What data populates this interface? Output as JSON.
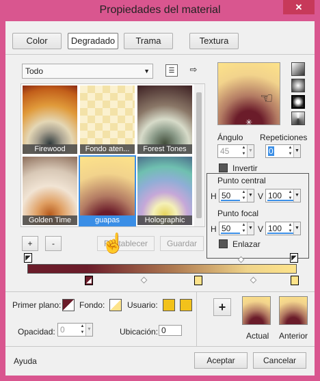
{
  "window": {
    "title": "Propiedades del material",
    "close_glyph": "✕"
  },
  "tabs": [
    {
      "label": "Color"
    },
    {
      "label": "Degradado"
    },
    {
      "label": "Trama"
    },
    {
      "label": "Textura"
    }
  ],
  "gallery": {
    "category": "Todo",
    "items": [
      {
        "label": "Firewood"
      },
      {
        "label": "Fondo aten..."
      },
      {
        "label": "Forest Tones"
      },
      {
        "label": "Golden Time"
      },
      {
        "label": "guapas"
      },
      {
        "label": "Holographic"
      }
    ],
    "selected_index": 4
  },
  "gallery_buttons": {
    "add": "+",
    "remove": "-",
    "reset": "Restablecer",
    "save": "Guardar"
  },
  "angle": {
    "label": "Ángulo",
    "value": "45"
  },
  "repetitions": {
    "label": "Repeticiones",
    "value": "0"
  },
  "invert": {
    "label": "Invertir"
  },
  "center_point": {
    "label": "Punto central",
    "h_label": "H",
    "h_value": "50",
    "v_label": "V",
    "v_value": "100"
  },
  "focal_point": {
    "label": "Punto focal",
    "h_label": "H",
    "h_value": "50",
    "v_label": "V",
    "v_value": "100"
  },
  "link": {
    "label": "Enlazar"
  },
  "bottom": {
    "foreground_label": "Primer plano:",
    "background_label": "Fondo:",
    "user_label": "Usuario:",
    "opacity_label": "Opacidad:",
    "opacity_value": "0",
    "location_label": "Ubicación:",
    "location_value": "0",
    "add_symbol": "+",
    "current_label": "Actual",
    "previous_label": "Anterior"
  },
  "footer": {
    "help": "Ayuda",
    "accept": "Aceptar",
    "cancel": "Cancelar"
  },
  "colors": {
    "titlebar": "#d9568f",
    "accent": "#3a8ee6",
    "dark_stop": "#6b1c2a",
    "light_stop": "#fde38a",
    "user_color": "#f2c21b"
  }
}
